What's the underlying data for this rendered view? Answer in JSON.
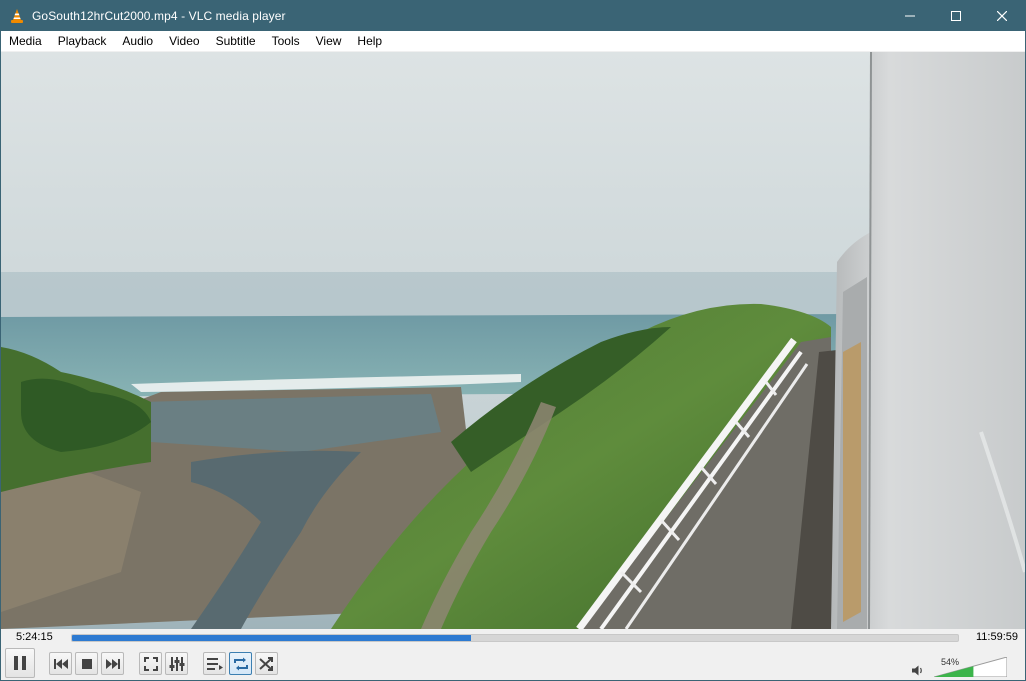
{
  "window": {
    "title": "GoSouth12hrCut2000.mp4 - VLC media player"
  },
  "menu": {
    "items": [
      "Media",
      "Playback",
      "Audio",
      "Video",
      "Subtitle",
      "Tools",
      "View",
      "Help"
    ]
  },
  "playback": {
    "elapsed": "5:24:15",
    "total": "11:59:59",
    "progress_fraction": 0.45
  },
  "volume": {
    "label": "54%",
    "level_fraction": 0.54
  },
  "controls": {
    "loop_active": true
  },
  "icons": {
    "app": "vlc-cone-icon",
    "minimize": "minimize-icon",
    "maximize": "maximize-icon",
    "close": "close-icon",
    "pause": "pause-icon",
    "previous": "previous-icon",
    "stop": "stop-icon",
    "next": "next-icon",
    "fullscreen": "fullscreen-icon",
    "extended_settings": "extended-settings-icon",
    "playlist": "playlist-icon",
    "loop": "loop-icon",
    "random": "shuffle-icon",
    "volume": "speaker-icon"
  },
  "colors": {
    "titlebar": "#3a6475",
    "seek_fill": "#2d7ad1",
    "volume_fill": "#3cb44b"
  }
}
